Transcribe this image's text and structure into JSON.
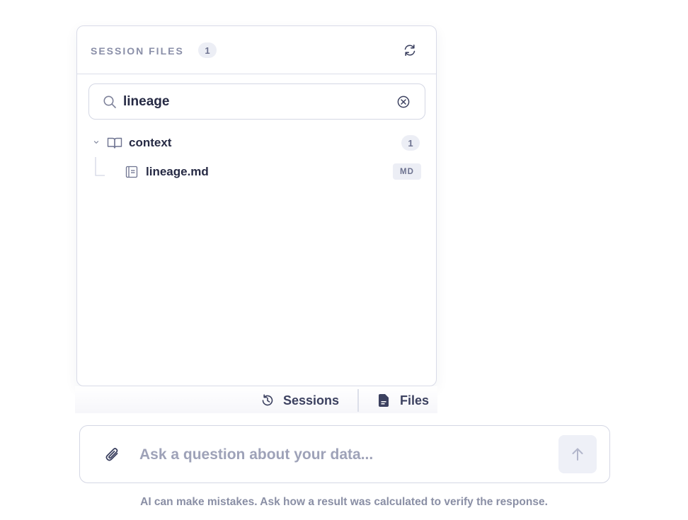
{
  "session_panel": {
    "title": "SESSION FILES",
    "count": "1",
    "refresh_icon": "refresh-icon",
    "search": {
      "value": "lineage",
      "icon": "search-icon",
      "clear_icon": "clear-circle-icon"
    },
    "tree": {
      "folder": {
        "label": "context",
        "count": "1",
        "icon": "book-icon",
        "expanded": true
      },
      "files": [
        {
          "label": "lineage.md",
          "badge": "MD",
          "icon": "document-icon"
        }
      ]
    }
  },
  "view_toggle": {
    "sessions": {
      "label": "Sessions",
      "icon": "history-icon"
    },
    "files": {
      "label": "Files",
      "icon": "files-icon",
      "active": true
    }
  },
  "chat": {
    "placeholder": "Ask a question about your data...",
    "attach_icon": "paperclip-icon",
    "send_icon": "arrow-up-icon"
  },
  "disclaimer": "AI can make mistakes. Ask how a result was calculated to verify the response.",
  "colors": {
    "text_primary": "#262a44",
    "text_muted": "#8a8fa8",
    "border": "#d4d7e4",
    "pill_bg": "#eceef5"
  }
}
